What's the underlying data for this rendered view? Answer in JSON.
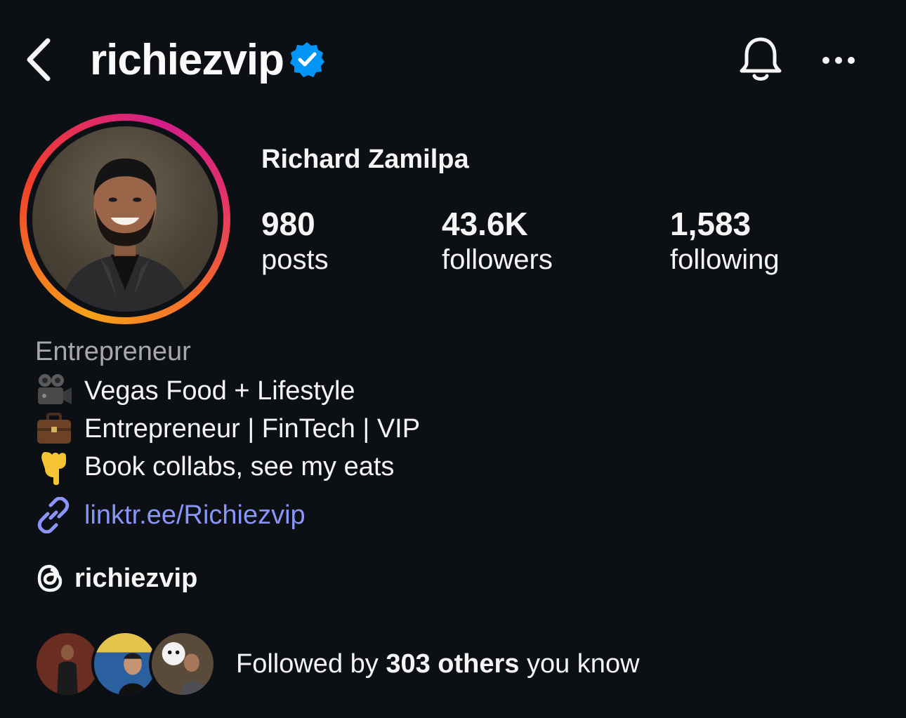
{
  "header": {
    "username": "richiezvip",
    "verified": true,
    "icons": [
      "back-chevron-icon",
      "verified-badge-icon",
      "bell-icon",
      "more-icon"
    ]
  },
  "profile": {
    "display_name": "Richard Zamilpa",
    "stats": [
      {
        "value": "980",
        "label": "posts"
      },
      {
        "value": "43.6K",
        "label": "followers"
      },
      {
        "value": "1,583",
        "label": "following"
      }
    ]
  },
  "bio": {
    "category": "Entrepreneur",
    "lines": [
      {
        "emoji": "movie-camera-icon",
        "text": "Vegas Food + Lifestyle"
      },
      {
        "emoji": "briefcase-icon",
        "text": "Entrepreneur | FinTech | VIP"
      },
      {
        "emoji": "pointing-down-icon",
        "text": "Book collabs, see my eats"
      }
    ],
    "link": "linktr.ee/Richiezvip",
    "threads_handle": "richiezvip"
  },
  "followed_by": {
    "prefix": "Followed by ",
    "count_text": "303 others",
    "suffix": " you know"
  },
  "colors": {
    "background": "#0c0f14",
    "link": "#8a95f8",
    "verified": "#0095f6",
    "category": "#a8a8a8"
  }
}
